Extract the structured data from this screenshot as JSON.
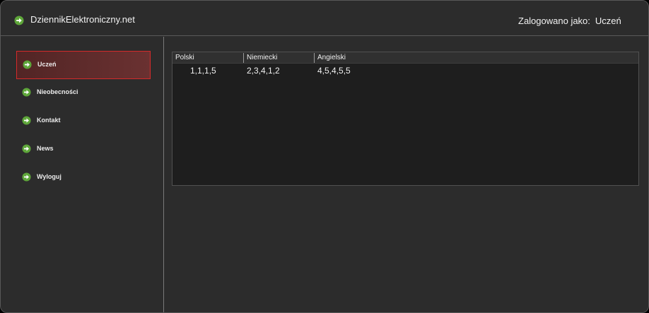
{
  "header": {
    "title": "DziennikElektroniczny.net",
    "logged_in_label": "Zalogowano jako:",
    "logged_in_user": "Uczeń"
  },
  "sidebar": {
    "items": [
      {
        "label": "Uczeń",
        "active": true,
        "icon": "arrow-right-icon"
      },
      {
        "label": "Nieobecności",
        "active": false,
        "icon": "arrow-right-icon"
      },
      {
        "label": "Kontakt",
        "active": false,
        "icon": "arrow-right-icon"
      },
      {
        "label": "News",
        "active": false,
        "icon": "arrow-right-icon"
      },
      {
        "label": "Wyloguj",
        "active": false,
        "icon": "arrow-right-icon"
      }
    ]
  },
  "grades": {
    "columns": [
      "Polski",
      "Niemiecki",
      "Angielski"
    ],
    "rows": [
      [
        "1,1,1,5",
        "2,3,4,1,2",
        "4,5,4,5,5"
      ]
    ]
  },
  "colors": {
    "background": "#2c2c2c",
    "table_background": "#1e1e1e",
    "active_border": "#d42a2a",
    "icon_green": "#5ea63a"
  }
}
